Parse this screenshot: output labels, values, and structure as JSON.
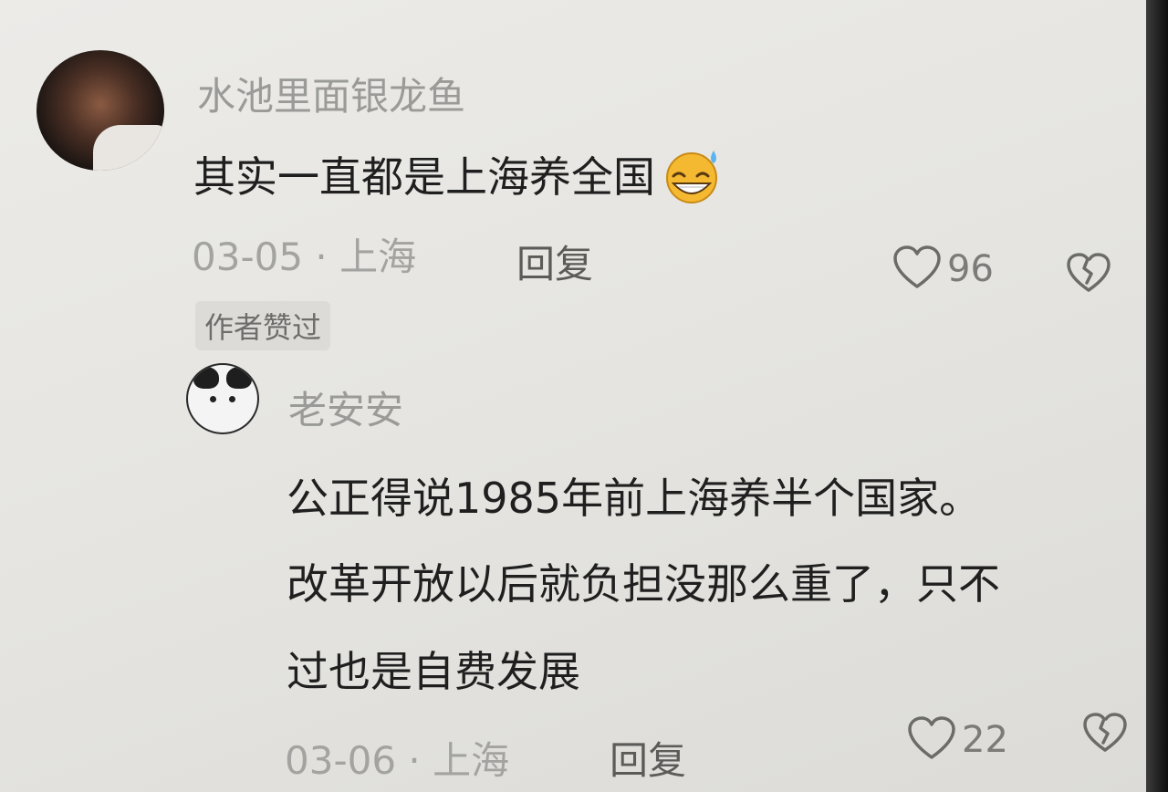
{
  "comments": [
    {
      "username": "水池里面银龙鱼",
      "text": "其实一直都是上海养全国",
      "emoji": "grinning-sweat-emoji",
      "date": "03-05",
      "separator": "·",
      "location": "上海",
      "reply_label": "回复",
      "likes": "96",
      "badge": "作者赞过"
    },
    {
      "username": "老安安",
      "text_lines": [
        "公正得说1985年前上海养半个国家。",
        "改革开放以后就负担没那么重了，只不",
        "过也是自费发展"
      ],
      "date": "03-06",
      "separator": "·",
      "location": "上海",
      "reply_label": "回复",
      "likes": "22"
    }
  ],
  "colors": {
    "background": "#e6e5e1",
    "text_primary": "#1f1f1f",
    "text_secondary": "#9a9a98",
    "badge_bg": "#dcdbd8"
  },
  "icons": {
    "like": "heart-outline-icon",
    "dislike": "broken-heart-icon"
  }
}
